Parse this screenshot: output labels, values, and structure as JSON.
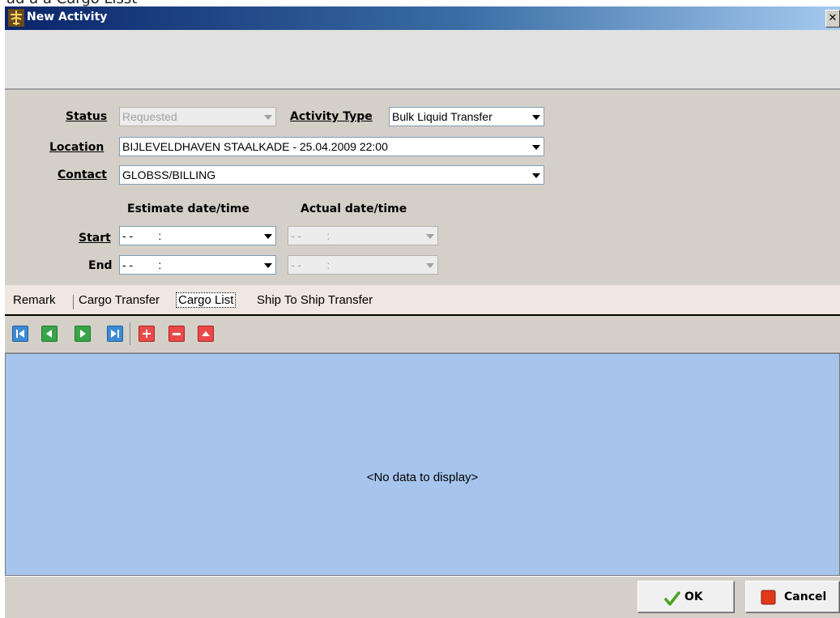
{
  "top_strip": {
    "text": "ad a a Cargo Lisst"
  },
  "window": {
    "title": "New Activity",
    "close_glyph": "✕"
  },
  "form": {
    "status": {
      "label": "Status",
      "value": "Requested"
    },
    "activity_type": {
      "label": "Activity Type",
      "value": "Bulk Liquid Transfer"
    },
    "location": {
      "label": "Location",
      "value": "BIJLEVELDHAVEN STAALKADE - 25.04.2009 22:00"
    },
    "contact": {
      "label": "Contact",
      "value": "GLOBSS/BILLING"
    },
    "estimate_header": "Estimate date/time",
    "actual_header": "Actual date/time",
    "start": {
      "label": "Start",
      "estimate_value": "- -        :",
      "actual_value": "- -        :"
    },
    "end": {
      "label": "End",
      "estimate_value": "- -        :",
      "actual_value": "- -        :"
    }
  },
  "tabs": [
    {
      "label": "Remark",
      "active": false
    },
    {
      "label": "Cargo Transfer",
      "active": false
    },
    {
      "label": "Cargo List",
      "active": true
    },
    {
      "label": "Ship To Ship Transfer",
      "active": false
    }
  ],
  "toolbar": {
    "icons": [
      "first-record-icon",
      "previous-record-icon",
      "next-record-icon",
      "last-record-icon",
      "add-record-icon",
      "delete-record-icon",
      "move-up-icon"
    ]
  },
  "grid": {
    "empty_text": "<No data to display>"
  },
  "buttons": {
    "ok_label": "OK",
    "cancel_label": "Cancel"
  },
  "colors": {
    "title_bar_start": "#0a246a",
    "grid_background": "#a6c4ec",
    "form_background": "#d4d0c8"
  }
}
